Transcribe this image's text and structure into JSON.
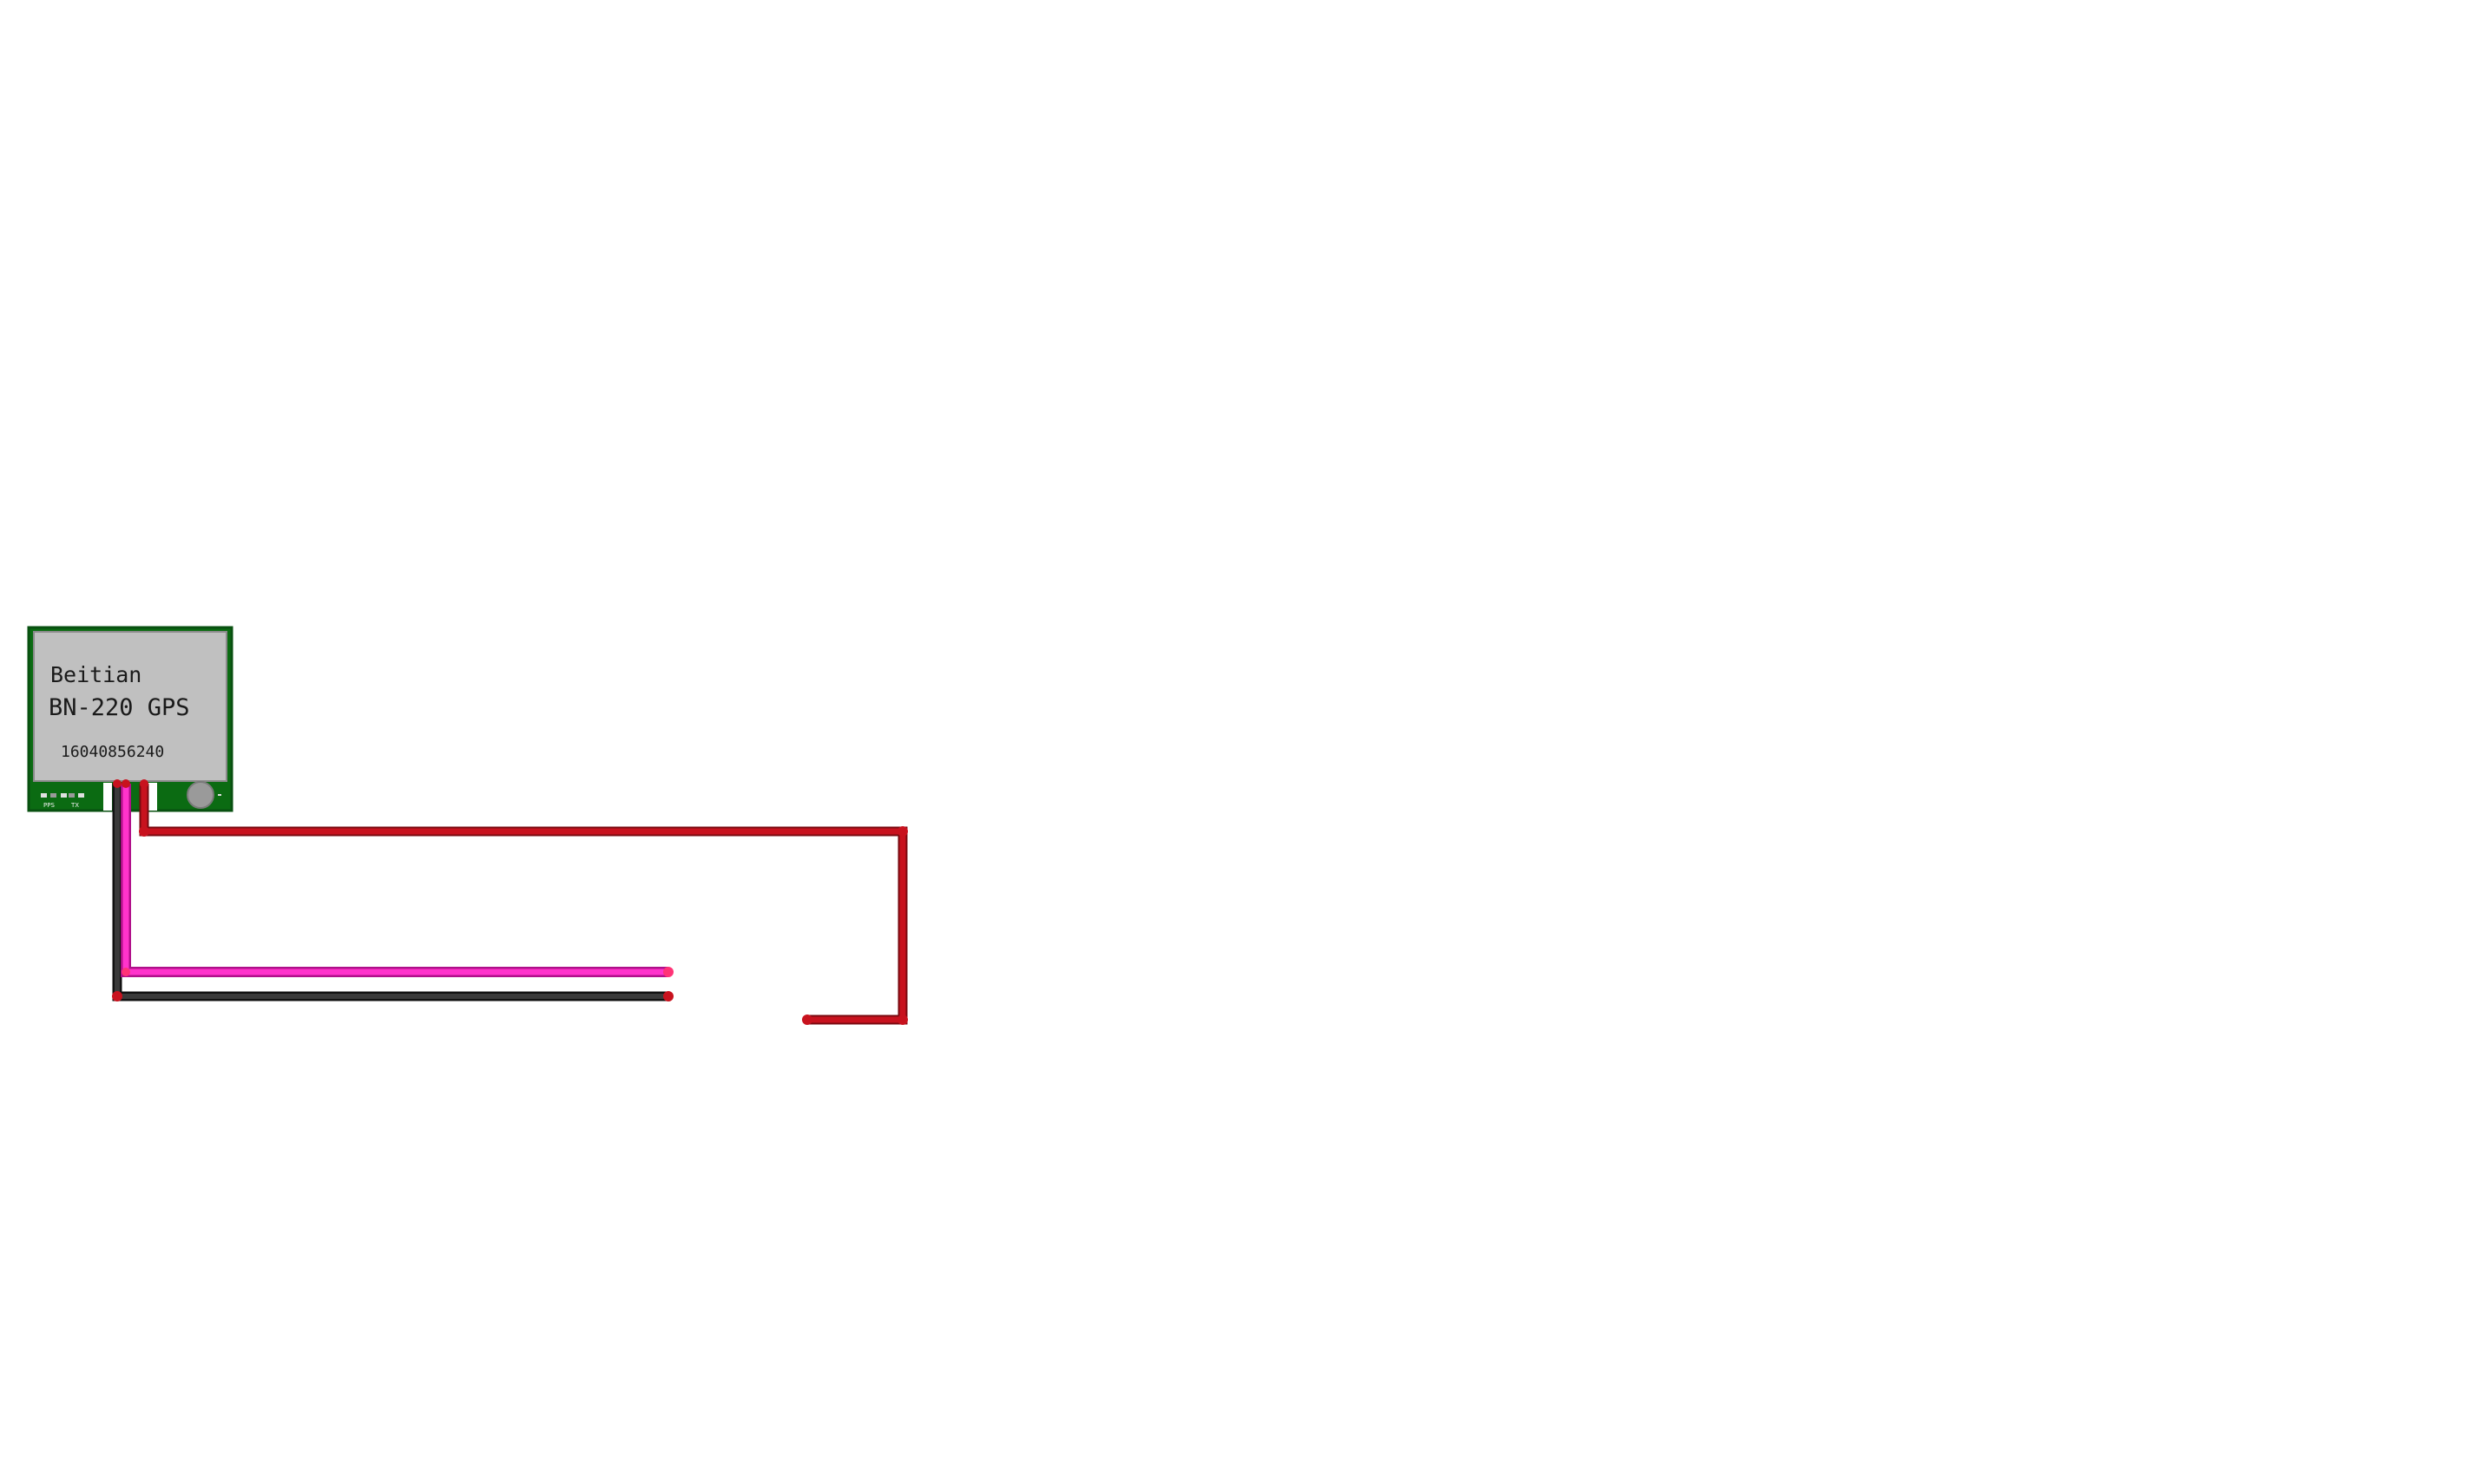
{
  "module": {
    "brand": "Beitian",
    "model": "BN-220 GPS",
    "serial": "16040856240",
    "led_labels": [
      "PPS",
      "TX"
    ],
    "colors": {
      "pcb": "#0b6b12",
      "shield": "#c0c0c0",
      "pad": "#9a9a9a"
    }
  },
  "wires": [
    {
      "name": "wire-red",
      "color": "#c8121e",
      "outline": "#7a0a10"
    },
    {
      "name": "wire-magenta",
      "color": "#ff33cc",
      "outline": "#b0108a"
    },
    {
      "name": "wire-black",
      "color": "#2b2b2b",
      "outline": "#111111"
    }
  ]
}
